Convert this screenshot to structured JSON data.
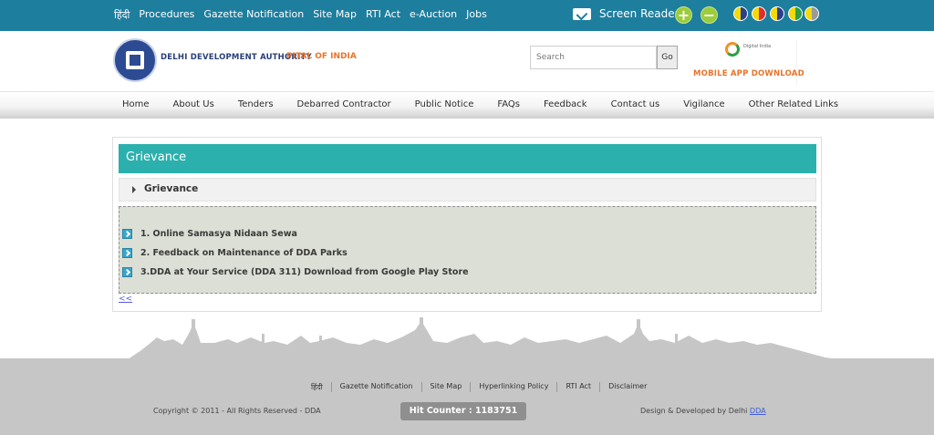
{
  "topbar": {
    "links": [
      "हिंदी",
      "Procedures",
      "Gazette Notification",
      "Site Map",
      "RTI Act",
      "e-Auction",
      "Jobs"
    ],
    "screen_reader": "Screen Reader",
    "font_increase": "+",
    "font_decrease": "−",
    "contrast_colors": [
      "#2d3f8c",
      "#e12d2d",
      "#2d3f8c",
      "#2f9e45",
      "#9a9a9a"
    ]
  },
  "header": {
    "org_name": "DELHI DEVELOPMENT AUTHORITY",
    "org_subtitle": "PITAL OF INDIA",
    "search": {
      "placeholder": "Search",
      "button": "Go"
    },
    "digital_india": "Digital India",
    "app_download": "MOBILE APP DOWNLOAD"
  },
  "nav": {
    "items": [
      "Home",
      "About Us",
      "Tenders",
      "Debarred Contractor",
      "Public Notice",
      "FAQs",
      "Feedback",
      "Contact us",
      "Vigilance",
      "Other Related Links"
    ]
  },
  "main": {
    "title": "Grievance",
    "accordion_label": "Grievance",
    "items": [
      "1. Online Samasya Nidaan Sewa",
      "2. Feedback on Maintenance of DDA Parks",
      "3.DDA at Your Service (DDA 311) Download from Google Play Store"
    ],
    "back_link": "<<"
  },
  "footer": {
    "links": [
      "हिंदी",
      "Gazette Notification",
      "Site Map",
      "Hyperlinking Policy",
      "RTI Act",
      "Disclaimer"
    ],
    "copyright": "Copyright © 2011 - All Rights Reserved - DDA",
    "hit_counter": "Hit Counter : 1183751",
    "developed_prefix": "Design & Developed by Delhi ",
    "developed_link": "DDA"
  },
  "colors": {
    "topbar": "#1d7e9e",
    "accent_teal": "#2bb0ad",
    "orange": "#e8742a",
    "footer": "#c6c6c6"
  }
}
